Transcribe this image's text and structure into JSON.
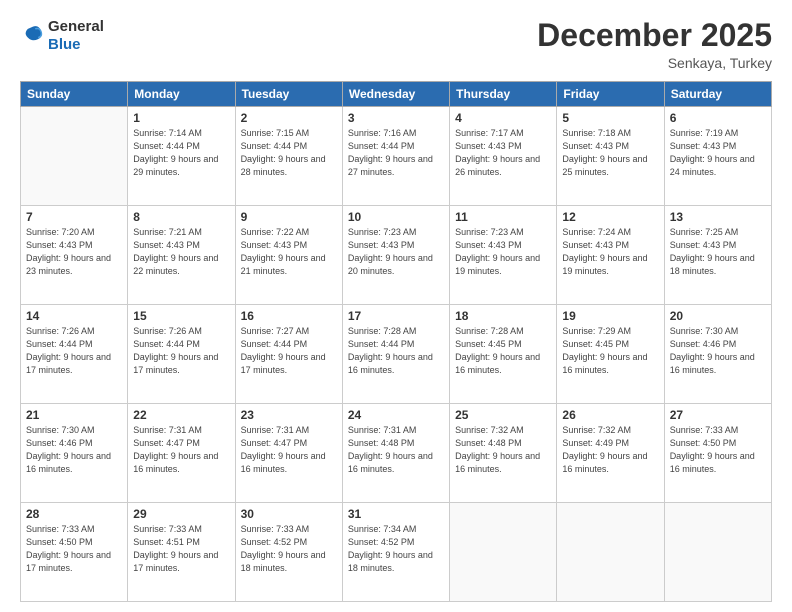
{
  "header": {
    "logo": {
      "general": "General",
      "blue": "Blue"
    },
    "title": "December 2025",
    "subtitle": "Senkaya, Turkey"
  },
  "weekdays": [
    "Sunday",
    "Monday",
    "Tuesday",
    "Wednesday",
    "Thursday",
    "Friday",
    "Saturday"
  ],
  "weeks": [
    [
      {
        "day": "",
        "sunrise": "",
        "sunset": "",
        "daylight": ""
      },
      {
        "day": "1",
        "sunrise": "Sunrise: 7:14 AM",
        "sunset": "Sunset: 4:44 PM",
        "daylight": "Daylight: 9 hours and 29 minutes."
      },
      {
        "day": "2",
        "sunrise": "Sunrise: 7:15 AM",
        "sunset": "Sunset: 4:44 PM",
        "daylight": "Daylight: 9 hours and 28 minutes."
      },
      {
        "day": "3",
        "sunrise": "Sunrise: 7:16 AM",
        "sunset": "Sunset: 4:44 PM",
        "daylight": "Daylight: 9 hours and 27 minutes."
      },
      {
        "day": "4",
        "sunrise": "Sunrise: 7:17 AM",
        "sunset": "Sunset: 4:43 PM",
        "daylight": "Daylight: 9 hours and 26 minutes."
      },
      {
        "day": "5",
        "sunrise": "Sunrise: 7:18 AM",
        "sunset": "Sunset: 4:43 PM",
        "daylight": "Daylight: 9 hours and 25 minutes."
      },
      {
        "day": "6",
        "sunrise": "Sunrise: 7:19 AM",
        "sunset": "Sunset: 4:43 PM",
        "daylight": "Daylight: 9 hours and 24 minutes."
      }
    ],
    [
      {
        "day": "7",
        "sunrise": "Sunrise: 7:20 AM",
        "sunset": "Sunset: 4:43 PM",
        "daylight": "Daylight: 9 hours and 23 minutes."
      },
      {
        "day": "8",
        "sunrise": "Sunrise: 7:21 AM",
        "sunset": "Sunset: 4:43 PM",
        "daylight": "Daylight: 9 hours and 22 minutes."
      },
      {
        "day": "9",
        "sunrise": "Sunrise: 7:22 AM",
        "sunset": "Sunset: 4:43 PM",
        "daylight": "Daylight: 9 hours and 21 minutes."
      },
      {
        "day": "10",
        "sunrise": "Sunrise: 7:23 AM",
        "sunset": "Sunset: 4:43 PM",
        "daylight": "Daylight: 9 hours and 20 minutes."
      },
      {
        "day": "11",
        "sunrise": "Sunrise: 7:23 AM",
        "sunset": "Sunset: 4:43 PM",
        "daylight": "Daylight: 9 hours and 19 minutes."
      },
      {
        "day": "12",
        "sunrise": "Sunrise: 7:24 AM",
        "sunset": "Sunset: 4:43 PM",
        "daylight": "Daylight: 9 hours and 19 minutes."
      },
      {
        "day": "13",
        "sunrise": "Sunrise: 7:25 AM",
        "sunset": "Sunset: 4:43 PM",
        "daylight": "Daylight: 9 hours and 18 minutes."
      }
    ],
    [
      {
        "day": "14",
        "sunrise": "Sunrise: 7:26 AM",
        "sunset": "Sunset: 4:44 PM",
        "daylight": "Daylight: 9 hours and 17 minutes."
      },
      {
        "day": "15",
        "sunrise": "Sunrise: 7:26 AM",
        "sunset": "Sunset: 4:44 PM",
        "daylight": "Daylight: 9 hours and 17 minutes."
      },
      {
        "day": "16",
        "sunrise": "Sunrise: 7:27 AM",
        "sunset": "Sunset: 4:44 PM",
        "daylight": "Daylight: 9 hours and 17 minutes."
      },
      {
        "day": "17",
        "sunrise": "Sunrise: 7:28 AM",
        "sunset": "Sunset: 4:44 PM",
        "daylight": "Daylight: 9 hours and 16 minutes."
      },
      {
        "day": "18",
        "sunrise": "Sunrise: 7:28 AM",
        "sunset": "Sunset: 4:45 PM",
        "daylight": "Daylight: 9 hours and 16 minutes."
      },
      {
        "day": "19",
        "sunrise": "Sunrise: 7:29 AM",
        "sunset": "Sunset: 4:45 PM",
        "daylight": "Daylight: 9 hours and 16 minutes."
      },
      {
        "day": "20",
        "sunrise": "Sunrise: 7:30 AM",
        "sunset": "Sunset: 4:46 PM",
        "daylight": "Daylight: 9 hours and 16 minutes."
      }
    ],
    [
      {
        "day": "21",
        "sunrise": "Sunrise: 7:30 AM",
        "sunset": "Sunset: 4:46 PM",
        "daylight": "Daylight: 9 hours and 16 minutes."
      },
      {
        "day": "22",
        "sunrise": "Sunrise: 7:31 AM",
        "sunset": "Sunset: 4:47 PM",
        "daylight": "Daylight: 9 hours and 16 minutes."
      },
      {
        "day": "23",
        "sunrise": "Sunrise: 7:31 AM",
        "sunset": "Sunset: 4:47 PM",
        "daylight": "Daylight: 9 hours and 16 minutes."
      },
      {
        "day": "24",
        "sunrise": "Sunrise: 7:31 AM",
        "sunset": "Sunset: 4:48 PM",
        "daylight": "Daylight: 9 hours and 16 minutes."
      },
      {
        "day": "25",
        "sunrise": "Sunrise: 7:32 AM",
        "sunset": "Sunset: 4:48 PM",
        "daylight": "Daylight: 9 hours and 16 minutes."
      },
      {
        "day": "26",
        "sunrise": "Sunrise: 7:32 AM",
        "sunset": "Sunset: 4:49 PM",
        "daylight": "Daylight: 9 hours and 16 minutes."
      },
      {
        "day": "27",
        "sunrise": "Sunrise: 7:33 AM",
        "sunset": "Sunset: 4:50 PM",
        "daylight": "Daylight: 9 hours and 16 minutes."
      }
    ],
    [
      {
        "day": "28",
        "sunrise": "Sunrise: 7:33 AM",
        "sunset": "Sunset: 4:50 PM",
        "daylight": "Daylight: 9 hours and 17 minutes."
      },
      {
        "day": "29",
        "sunrise": "Sunrise: 7:33 AM",
        "sunset": "Sunset: 4:51 PM",
        "daylight": "Daylight: 9 hours and 17 minutes."
      },
      {
        "day": "30",
        "sunrise": "Sunrise: 7:33 AM",
        "sunset": "Sunset: 4:52 PM",
        "daylight": "Daylight: 9 hours and 18 minutes."
      },
      {
        "day": "31",
        "sunrise": "Sunrise: 7:34 AM",
        "sunset": "Sunset: 4:52 PM",
        "daylight": "Daylight: 9 hours and 18 minutes."
      },
      {
        "day": "",
        "sunrise": "",
        "sunset": "",
        "daylight": ""
      },
      {
        "day": "",
        "sunrise": "",
        "sunset": "",
        "daylight": ""
      },
      {
        "day": "",
        "sunrise": "",
        "sunset": "",
        "daylight": ""
      }
    ]
  ]
}
